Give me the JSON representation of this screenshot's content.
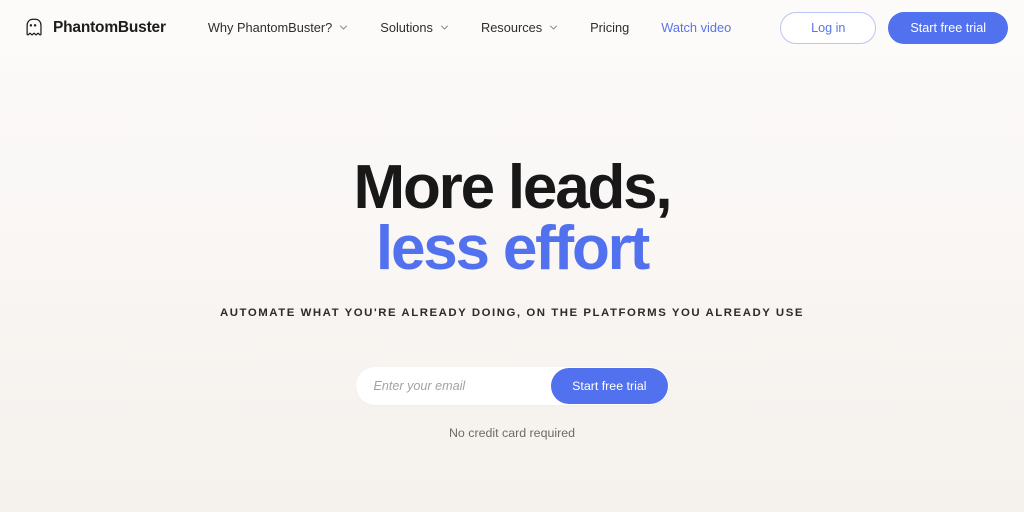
{
  "colors": {
    "accent_blue": "#5271EE",
    "link_blue": "#5A74E8",
    "outline_border": "#B9C5F4",
    "headline_dark": "#181818",
    "bg_top": "#FCFBFA",
    "bg_bottom": "#F5F1EC",
    "placeholder_gray": "#A5A2A0",
    "note_gray": "#6D6A68"
  },
  "header": {
    "brand": {
      "name": "PhantomBuster",
      "icon": "ghost-icon"
    },
    "nav": [
      {
        "label": "Why PhantomBuster?",
        "has_chevron": true,
        "style": "default"
      },
      {
        "label": "Solutions",
        "has_chevron": true,
        "style": "default"
      },
      {
        "label": "Resources",
        "has_chevron": true,
        "style": "default"
      },
      {
        "label": "Pricing",
        "has_chevron": false,
        "style": "default"
      },
      {
        "label": "Watch video",
        "has_chevron": false,
        "style": "link-blue"
      }
    ],
    "actions": {
      "login_label": "Log in",
      "trial_label": "Start free trial"
    }
  },
  "hero": {
    "headline_line1": "More leads,",
    "headline_line2": "less effort",
    "subheadline": "AUTOMATE WHAT YOU'RE ALREADY DOING, ON THE PLATFORMS YOU ALREADY USE",
    "signup": {
      "email_placeholder": "Enter your email",
      "email_value": "",
      "submit_label": "Start free trial"
    },
    "note": "No credit card required"
  }
}
